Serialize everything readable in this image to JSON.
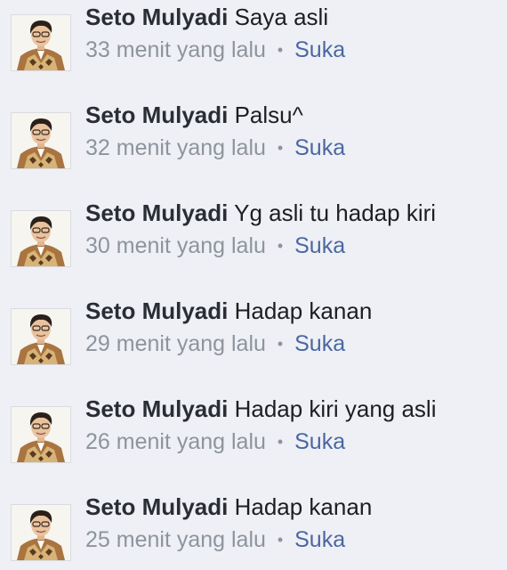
{
  "comments": [
    {
      "author": "Seto Mulyadi",
      "text": "Saya asli",
      "time": "33 menit yang lalu",
      "separator": "•",
      "like": "Suka"
    },
    {
      "author": "Seto Mulyadi",
      "text": "Palsu^",
      "time": "32 menit yang lalu",
      "separator": "•",
      "like": "Suka"
    },
    {
      "author": "Seto Mulyadi",
      "text": "Yg asli tu hadap kiri",
      "time": "30 menit yang lalu",
      "separator": "•",
      "like": "Suka"
    },
    {
      "author": "Seto Mulyadi",
      "text": "Hadap kanan",
      "time": "29 menit yang lalu",
      "separator": "•",
      "like": "Suka"
    },
    {
      "author": "Seto Mulyadi",
      "text": "Hadap kiri yang asli",
      "time": "26 menit yang lalu",
      "separator": "•",
      "like": "Suka"
    },
    {
      "author": "Seto Mulyadi",
      "text": "Hadap kanan",
      "time": "25 menit yang lalu",
      "separator": "•",
      "like": "Suka"
    }
  ],
  "colors": {
    "background": "#eef0f5",
    "author": "#2a2d34",
    "meta": "#8d949e",
    "like_link": "#4b67a1"
  },
  "icons": {
    "avatar": "profile-photo-man-batik"
  }
}
